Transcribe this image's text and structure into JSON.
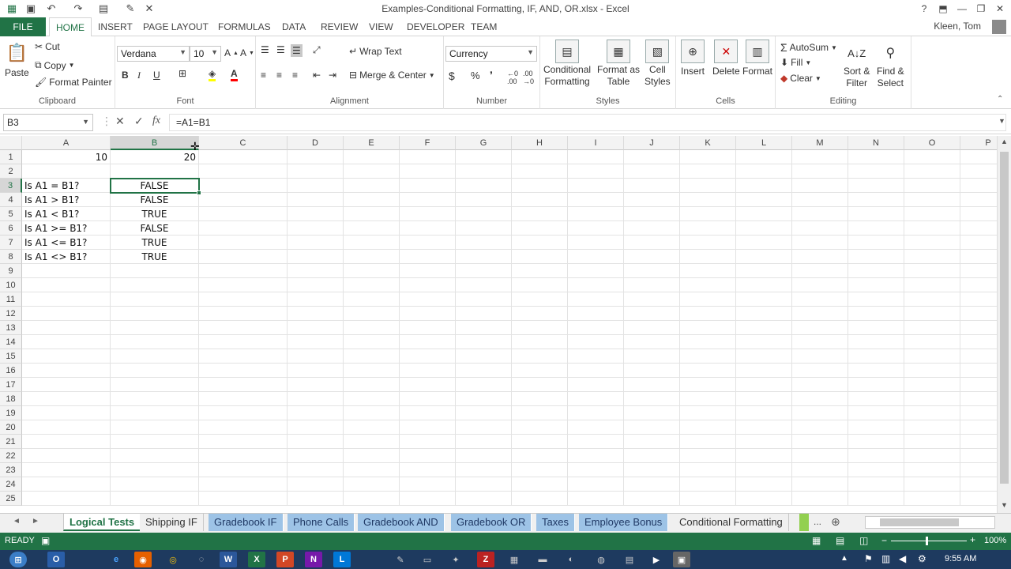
{
  "window": {
    "title": "Examples-Conditional Formatting, IF, AND, OR.xlsx - Excel",
    "help": "?",
    "min": "—",
    "restore": "❐",
    "close": "✕"
  },
  "qat": {
    "save": "💾",
    "undo": "↶",
    "redo": "↷"
  },
  "tabs": [
    "FILE",
    "HOME",
    "INSERT",
    "PAGE LAYOUT",
    "FORMULAS",
    "DATA",
    "REVIEW",
    "VIEW",
    "DEVELOPER",
    "TEAM"
  ],
  "user": "Kleen, Tom",
  "ribbon": {
    "clipboard": {
      "paste": "Paste",
      "cut": "Cut",
      "copy": "Copy",
      "format_painter": "Format Painter",
      "label": "Clipboard"
    },
    "font": {
      "name": "Verdana",
      "size": "10",
      "bold": "B",
      "italic": "I",
      "underline": "U",
      "label": "Font"
    },
    "alignment": {
      "wrap": "Wrap Text",
      "merge": "Merge & Center",
      "label": "Alignment"
    },
    "number": {
      "format": "Currency",
      "currency": "$",
      "percent": "%",
      "comma": "❜",
      "label": "Number"
    },
    "styles": {
      "conditional": "Conditional",
      "conditional2": "Formatting",
      "format_table": "Format as",
      "format_table2": "Table",
      "cell_styles": "Cell",
      "cell_styles2": "Styles",
      "label": "Styles"
    },
    "cells": {
      "insert": "Insert",
      "delete": "Delete",
      "format": "Format",
      "label": "Cells"
    },
    "editing": {
      "autosum": "AutoSum",
      "fill": "Fill",
      "clear": "Clear",
      "sort": "Sort &",
      "sort2": "Filter",
      "find": "Find &",
      "find2": "Select",
      "label": "Editing"
    }
  },
  "formula_bar": {
    "name_box": "B3",
    "cancel": "✕",
    "enter": "✓",
    "fx": "fx",
    "formula": "=A1=B1"
  },
  "grid": {
    "columns": [
      "A",
      "B",
      "C",
      "D",
      "E",
      "F",
      "G",
      "H",
      "I",
      "J",
      "K",
      "L",
      "M",
      "N",
      "O",
      "P"
    ],
    "rows": [
      "1",
      "2",
      "3",
      "4",
      "5",
      "6",
      "7",
      "8",
      "9",
      "10",
      "11",
      "12",
      "13",
      "14",
      "15",
      "16",
      "17",
      "18",
      "19",
      "20",
      "21",
      "22",
      "23",
      "24",
      "25"
    ],
    "cells": {
      "A1": "10",
      "B1": "20",
      "A3": "Is A1 = B1?",
      "B3": "FALSE",
      "A4": "Is A1 > B1?",
      "B4": "FALSE",
      "A5": "Is A1 < B1?",
      "B5": "TRUE",
      "A6": "Is A1 >= B1?",
      "B6": "FALSE",
      "A7": "Is A1 <= B1?",
      "B7": "TRUE",
      "A8": "Is A1 <> B1?",
      "B8": "TRUE"
    }
  },
  "sheets": [
    "Logical Tests",
    "Shipping IF",
    "Gradebook IF",
    "Phone Calls",
    "Gradebook AND",
    "Gradebook OR",
    "Taxes",
    "Employee Bonus",
    "Conditional Formatting",
    "..."
  ],
  "status": {
    "ready": "READY",
    "zoom": "100%"
  },
  "taskbar": {
    "time": "9:55 AM"
  },
  "colors": {
    "excel_green": "#217346",
    "tab_blue": "#9dc3e6"
  }
}
